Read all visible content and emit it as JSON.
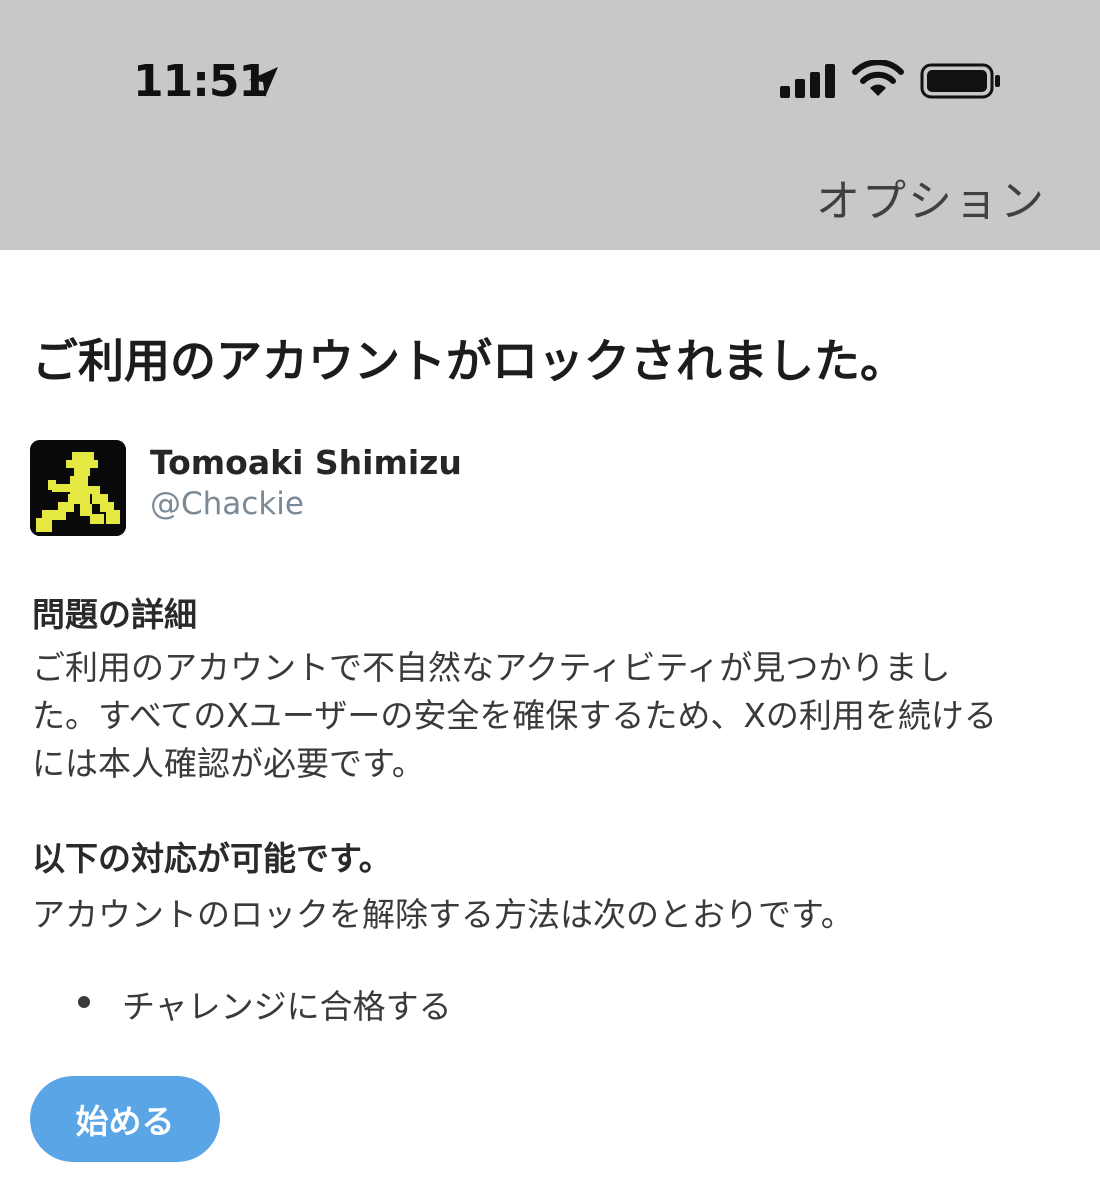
{
  "status_bar": {
    "time": "11:51",
    "icons": [
      "location-arrow-icon",
      "cellular-signal-icon",
      "wifi-icon",
      "battery-icon"
    ]
  },
  "header": {
    "options_label": "オプション",
    "background": "#c8c8c8"
  },
  "main": {
    "title": "ご利用のアカウントがロックされました。",
    "user": {
      "name": "Tomoaki Shimizu",
      "handle": "@Chackie"
    },
    "details": {
      "heading": "問題の詳細",
      "lines": [
        "ご利用のアカウントで不自然なアクティビティが見つかりまし",
        "た。すべてのXユーザーの安全を確保するため、Xの利用を続ける",
        "には本人確認が必要です。"
      ]
    },
    "options": {
      "heading": "以下の対応が可能です。",
      "text": "アカウントのロックを解除する方法は次のとおりです。",
      "items": [
        "チャレンジに合格する"
      ]
    },
    "start_button_label": "始める",
    "accent_color": "#5aa5e6"
  }
}
